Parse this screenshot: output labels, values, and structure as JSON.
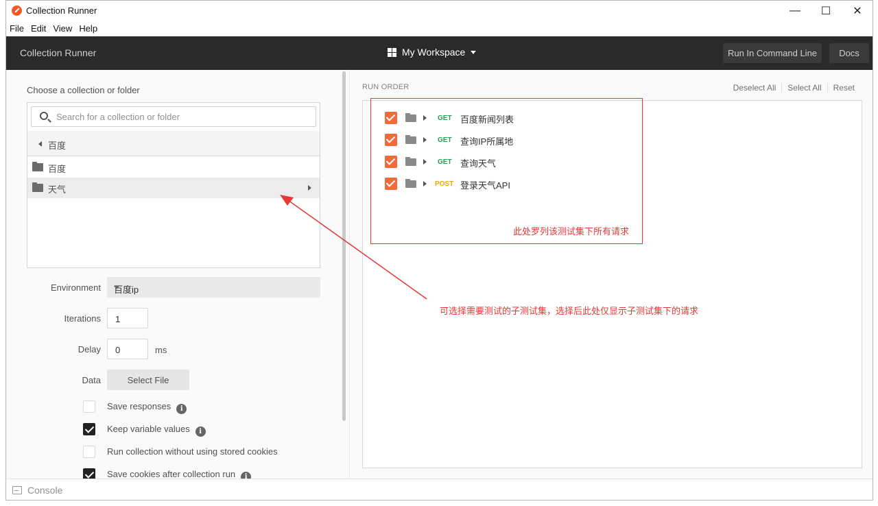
{
  "window": {
    "title": "Collection Runner",
    "controls": {
      "minimize": "—",
      "maximize": "☐",
      "close": "✕"
    }
  },
  "menu": [
    "File",
    "Edit",
    "View",
    "Help"
  ],
  "header": {
    "title": "Collection Runner",
    "workspace": "My Workspace",
    "run_cli_label": "Run In Command Line",
    "docs_label": "Docs"
  },
  "left": {
    "choose_label": "Choose a collection or folder",
    "search": {
      "placeholder": "Search for a collection or folder",
      "value": ""
    },
    "breadcrumb": "百度",
    "folders": [
      {
        "label": "百度",
        "selected": false
      },
      {
        "label": "天气",
        "selected": true
      }
    ],
    "environment": {
      "label": "Environment",
      "value": "百度ip"
    },
    "iterations": {
      "label": "Iterations",
      "value": "1"
    },
    "delay": {
      "label": "Delay",
      "value": "0",
      "unit": "ms"
    },
    "data": {
      "label": "Data",
      "button": "Select File"
    },
    "options": [
      {
        "label": "Save responses",
        "checked": false,
        "info": "i"
      },
      {
        "label": "Keep variable values",
        "checked": true,
        "info": "i"
      },
      {
        "label": "Run collection without using stored cookies",
        "checked": false
      },
      {
        "label": "Save cookies after collection run",
        "checked": true,
        "info": "i"
      }
    ]
  },
  "right": {
    "run_order_label": "RUN ORDER",
    "actions": {
      "deselect_all": "Deselect All",
      "select_all": "Select All",
      "reset": "Reset"
    },
    "requests": [
      {
        "method": "GET",
        "name": "百度新闻列表",
        "checked": true
      },
      {
        "method": "GET",
        "name": "查询IP所属地",
        "checked": true
      },
      {
        "method": "GET",
        "name": "查询天气",
        "checked": true
      },
      {
        "method": "POST",
        "name": "登录天气API",
        "checked": true
      }
    ]
  },
  "annotations": {
    "box_note": "此处罗列该测试集下所有请求",
    "arrow_note": "可选择需要测试的子测试集，选择后此处仅显示子测试集下的请求"
  },
  "colors": {
    "accent": "#f26b3a",
    "get": "#2e9e4f",
    "post": "#f0a500",
    "annotation": "#e53935",
    "header_bg": "#2a2a2a"
  },
  "status": {
    "console_label": "Console"
  }
}
